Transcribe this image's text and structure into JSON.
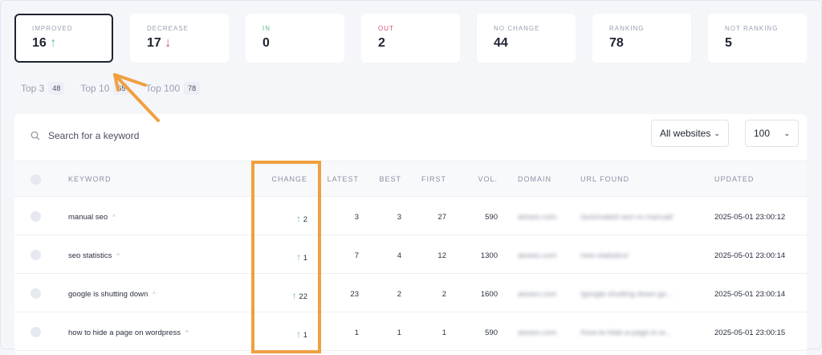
{
  "stats": [
    {
      "label": "IMPROVED",
      "value": "16",
      "icon": "arrow-up-icon",
      "selected": true
    },
    {
      "label": "DECREASE",
      "value": "17",
      "icon": "arrow-down-icon"
    },
    {
      "label": "IN",
      "value": "0",
      "label_color": "#5fbf8a"
    },
    {
      "label": "OUT",
      "value": "2",
      "label_color": "#d0556b"
    },
    {
      "label": "NO CHANGE",
      "value": "44"
    },
    {
      "label": "RANKING",
      "value": "78"
    },
    {
      "label": "NOT RANKING",
      "value": "5"
    }
  ],
  "tabs": [
    {
      "label": "Top 3",
      "count": "48"
    },
    {
      "label": "Top 10",
      "count": "65"
    },
    {
      "label": "Top 100",
      "count": "78"
    }
  ],
  "search": {
    "placeholder": "Search for a keyword"
  },
  "filters": {
    "website": "All websites",
    "per_page": "100"
  },
  "columns": [
    "KEYWORD",
    "CHANGE",
    "LATEST",
    "BEST",
    "FIRST",
    "VOL.",
    "DOMAIN",
    "URL FOUND",
    "UPDATED"
  ],
  "rows": [
    {
      "keyword": "manual seo",
      "change": "2",
      "latest": "3",
      "best": "3",
      "first": "27",
      "vol": "590",
      "domain": "aioseo.com",
      "url": "/automated-seo-vs-manual/",
      "updated": "2025-05-01 23:00:12"
    },
    {
      "keyword": "seo statistics",
      "change": "1",
      "latest": "7",
      "best": "4",
      "first": "12",
      "vol": "1300",
      "domain": "aioseo.com",
      "url": "/seo-statistics/",
      "updated": "2025-05-01 23:00:14"
    },
    {
      "keyword": "google is shutting down",
      "change": "22",
      "latest": "23",
      "best": "2",
      "first": "2",
      "vol": "1600",
      "domain": "aioseo.com",
      "url": "/google-shutting-down-go...",
      "updated": "2025-05-01 23:00:14"
    },
    {
      "keyword": "how to hide a page on wordpress",
      "change": "1",
      "latest": "1",
      "best": "1",
      "first": "1",
      "vol": "590",
      "domain": "aioseo.com",
      "url": "/how-to-hide-a-page-in-w...",
      "updated": "2025-05-01 23:00:15"
    }
  ],
  "colors": {
    "annotation": "#f0a040",
    "up": "#5fbf8a",
    "down": "#d0556b"
  }
}
